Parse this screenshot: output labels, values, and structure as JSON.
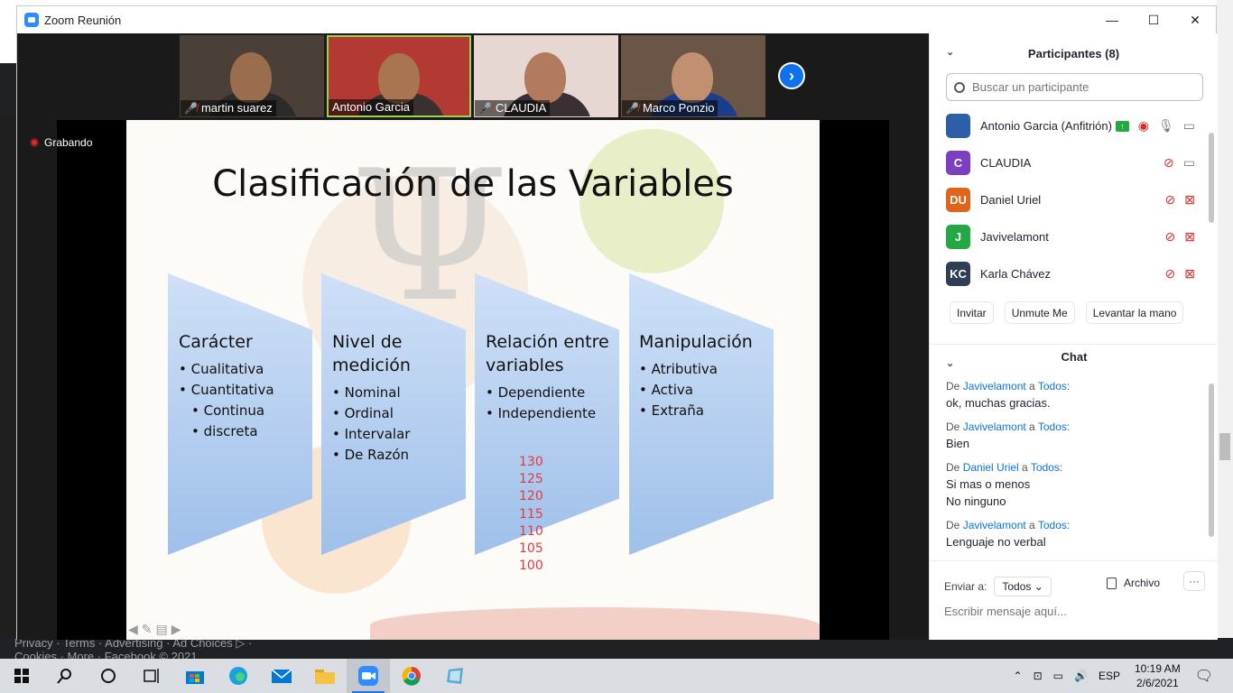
{
  "window": {
    "title": "Zoom Reunión"
  },
  "background": {
    "footer_links": "Privacy · Terms · Advertising · Ad Choices ▷ ·",
    "footer_links2": "Cookies · More · Facebook © 2021"
  },
  "videos": [
    {
      "name": "martin suarez",
      "muted": true
    },
    {
      "name": "Antonio Garcia",
      "muted": false
    },
    {
      "name": "CLAUDIA",
      "muted": true
    },
    {
      "name": "Marco Ponzio",
      "muted": true
    }
  ],
  "recording": {
    "label": "Grabando"
  },
  "slide": {
    "title": "Clasificación de las Variables",
    "cards": [
      {
        "heading": "Carácter",
        "items": [
          "Cualitativa",
          "Cuantitativa"
        ],
        "subitems": [
          "Continua",
          "discreta"
        ]
      },
      {
        "heading": "Nivel de medición",
        "items": [
          "Nominal",
          "Ordinal",
          "Intervalar",
          "De Razón"
        ]
      },
      {
        "heading": "Relación entre variables",
        "items": [
          "Dependiente",
          "Independiente"
        ]
      },
      {
        "heading": "Manipulación",
        "items": [
          "Atributiva",
          "Activa",
          "Extraña"
        ]
      }
    ],
    "numbers": [
      "130",
      "125",
      "120",
      "115",
      "110",
      "105",
      "100"
    ]
  },
  "participants": {
    "header": "Participantes (8)",
    "search_placeholder": "Buscar un participante",
    "list": [
      {
        "name": "Antonio Garcia (Anfitrión)",
        "initials": "",
        "color": "#2c5fa8"
      },
      {
        "name": "CLAUDIA",
        "initials": "C",
        "color": "#7c3fbf"
      },
      {
        "name": "Daniel Uriel",
        "initials": "DU",
        "color": "#e0641a"
      },
      {
        "name": "Javivelamont",
        "initials": "J",
        "color": "#23a844"
      },
      {
        "name": "Karla Chávez",
        "initials": "KC",
        "color": "#2f3d56"
      }
    ],
    "buttons": {
      "invite": "Invitar",
      "unmute": "Unmute Me",
      "raise": "Levantar la mano"
    }
  },
  "chat": {
    "header": "Chat",
    "messages": [
      {
        "from": "Javivelamont",
        "to": "Todos",
        "lines": [
          "ok, muchas gracias."
        ]
      },
      {
        "from": "Javivelamont",
        "to": "Todos",
        "lines": [
          "Bien"
        ]
      },
      {
        "from": "Daniel Uriel",
        "to": "Todos",
        "lines": [
          "Si mas o menos",
          "No ninguno"
        ]
      },
      {
        "from": "Javivelamont",
        "to": "Todos",
        "lines": [
          "Lenguaje no verbal"
        ]
      }
    ],
    "send_to_label": "Enviar a:",
    "send_to_value": "Todos",
    "file_label": "Archivo",
    "input_placeholder": "Escribir mensaje aquí..."
  },
  "taskbar": {
    "lang": "ESP",
    "time": "10:19 AM",
    "date": "2/6/2021"
  }
}
